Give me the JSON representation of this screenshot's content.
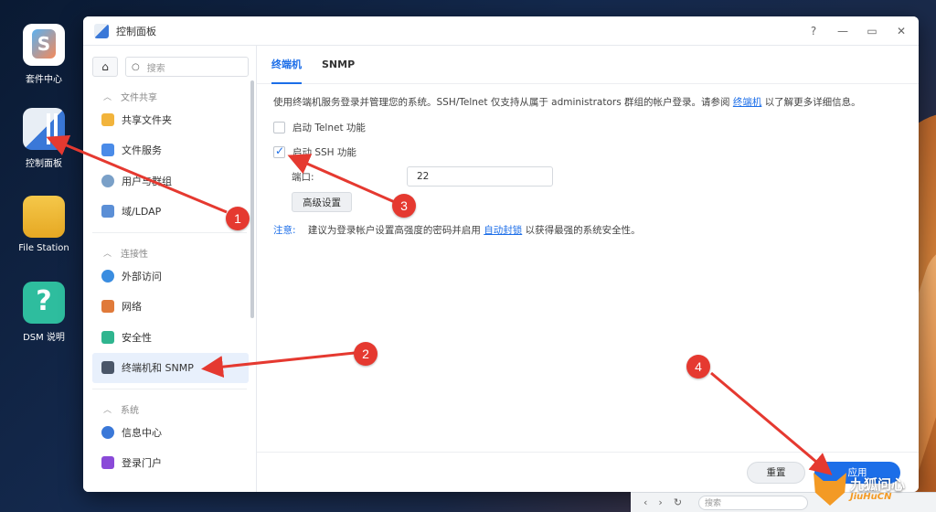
{
  "desktop": {
    "icons": [
      {
        "label": "套件中心",
        "icon": "package-center-icon"
      },
      {
        "label": "控制面板",
        "icon": "control-panel-icon"
      },
      {
        "label": "File Station",
        "icon": "file-station-icon"
      },
      {
        "label": "DSM 说明",
        "icon": "help-icon"
      }
    ]
  },
  "window": {
    "title": "控制面板",
    "controls": {
      "help": "?",
      "minimize": "—",
      "maximize": "▭",
      "close": "✕"
    }
  },
  "sidebar": {
    "search_placeholder": "搜索",
    "sections": [
      {
        "title": "文件共享",
        "items": [
          "共享文件夹",
          "文件服务",
          "用户与群组",
          "域/LDAP"
        ]
      },
      {
        "title": "连接性",
        "items": [
          "外部访问",
          "网络",
          "安全性",
          "终端机和 SNMP"
        ]
      },
      {
        "title": "系统",
        "items": [
          "信息中心",
          "登录门户"
        ]
      }
    ],
    "active_item": "终端机和 SNMP"
  },
  "tabs": [
    "终端机",
    "SNMP"
  ],
  "active_tab": "终端机",
  "content": {
    "desc_prefix": "使用终端机服务登录并管理您的系统。SSH/Telnet 仅支持从属于 administrators 群组的帐户登录。请参阅",
    "desc_link": "终端机",
    "desc_suffix": "以了解更多详细信息。",
    "telnet_label": "启动 Telnet 功能",
    "telnet_checked": false,
    "ssh_label": "启动 SSH 功能",
    "ssh_checked": true,
    "port_label": "端口:",
    "port_value": "22",
    "advanced_button": "高级设置",
    "note_label": "注意:",
    "note_prefix": "建议为登录帐户设置高强度的密码并启用",
    "note_link": "自动封锁",
    "note_suffix": "以获得最强的系统安全性。"
  },
  "footer": {
    "reset_label": "重置",
    "apply_label": "应用"
  },
  "browser": {
    "back": "‹",
    "forward": "›",
    "refresh": "↻",
    "search_placeholder": "搜索"
  },
  "annotations": [
    "1",
    "2",
    "3",
    "4"
  ],
  "watermark": {
    "line1": "九狐问心",
    "line2": "JiuHuCN"
  },
  "colors": {
    "accent": "#1c6ee8",
    "annotation": "#e53930"
  }
}
